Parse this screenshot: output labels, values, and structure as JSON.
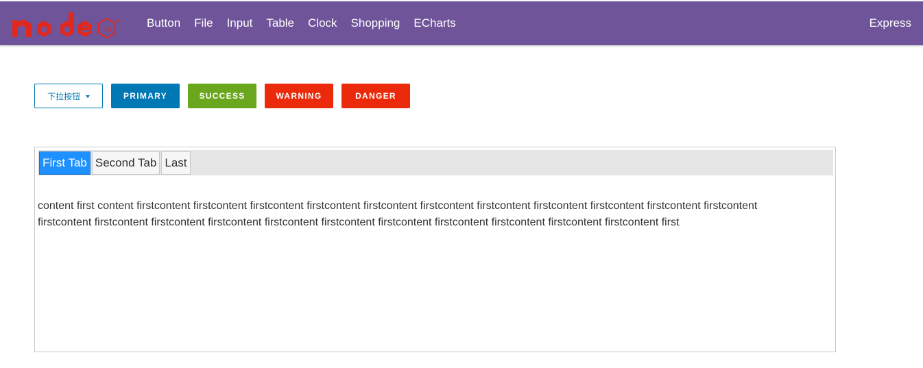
{
  "nav": {
    "links": [
      "Button",
      "File",
      "Input",
      "Table",
      "Clock",
      "Shopping",
      "ECharts"
    ],
    "right_label": "Express",
    "logo_letters": "node",
    "logo_badge": "JS",
    "colors": {
      "bar": "#6f5499",
      "logo": "#e0281f"
    }
  },
  "buttons": {
    "dropdown_label": "下拉按钮",
    "primary_label": "PRIMARY",
    "success_label": "SUCCESS",
    "warning_label": "WARNING",
    "danger_label": "DANGER",
    "colors": {
      "primary": "#0078b4",
      "success": "#6aa71c",
      "warning": "#ea2a0a",
      "danger": "#ea2a0a"
    }
  },
  "tabs": {
    "items": [
      {
        "label": "First Tab",
        "active": true
      },
      {
        "label": "Second Tab",
        "active": false
      },
      {
        "label": "Last",
        "active": false
      }
    ],
    "content": "content first content firstcontent firstcontent firstcontent firstcontent firstcontent firstcontent firstcontent firstcontent firstcontent firstcontent firstcontent firstcontent firstcontent firstcontent firstcontent firstcontent firstcontent firstcontent firstcontent firstcontent firstcontent firstcontent first",
    "active_color": "#1e90ff"
  }
}
